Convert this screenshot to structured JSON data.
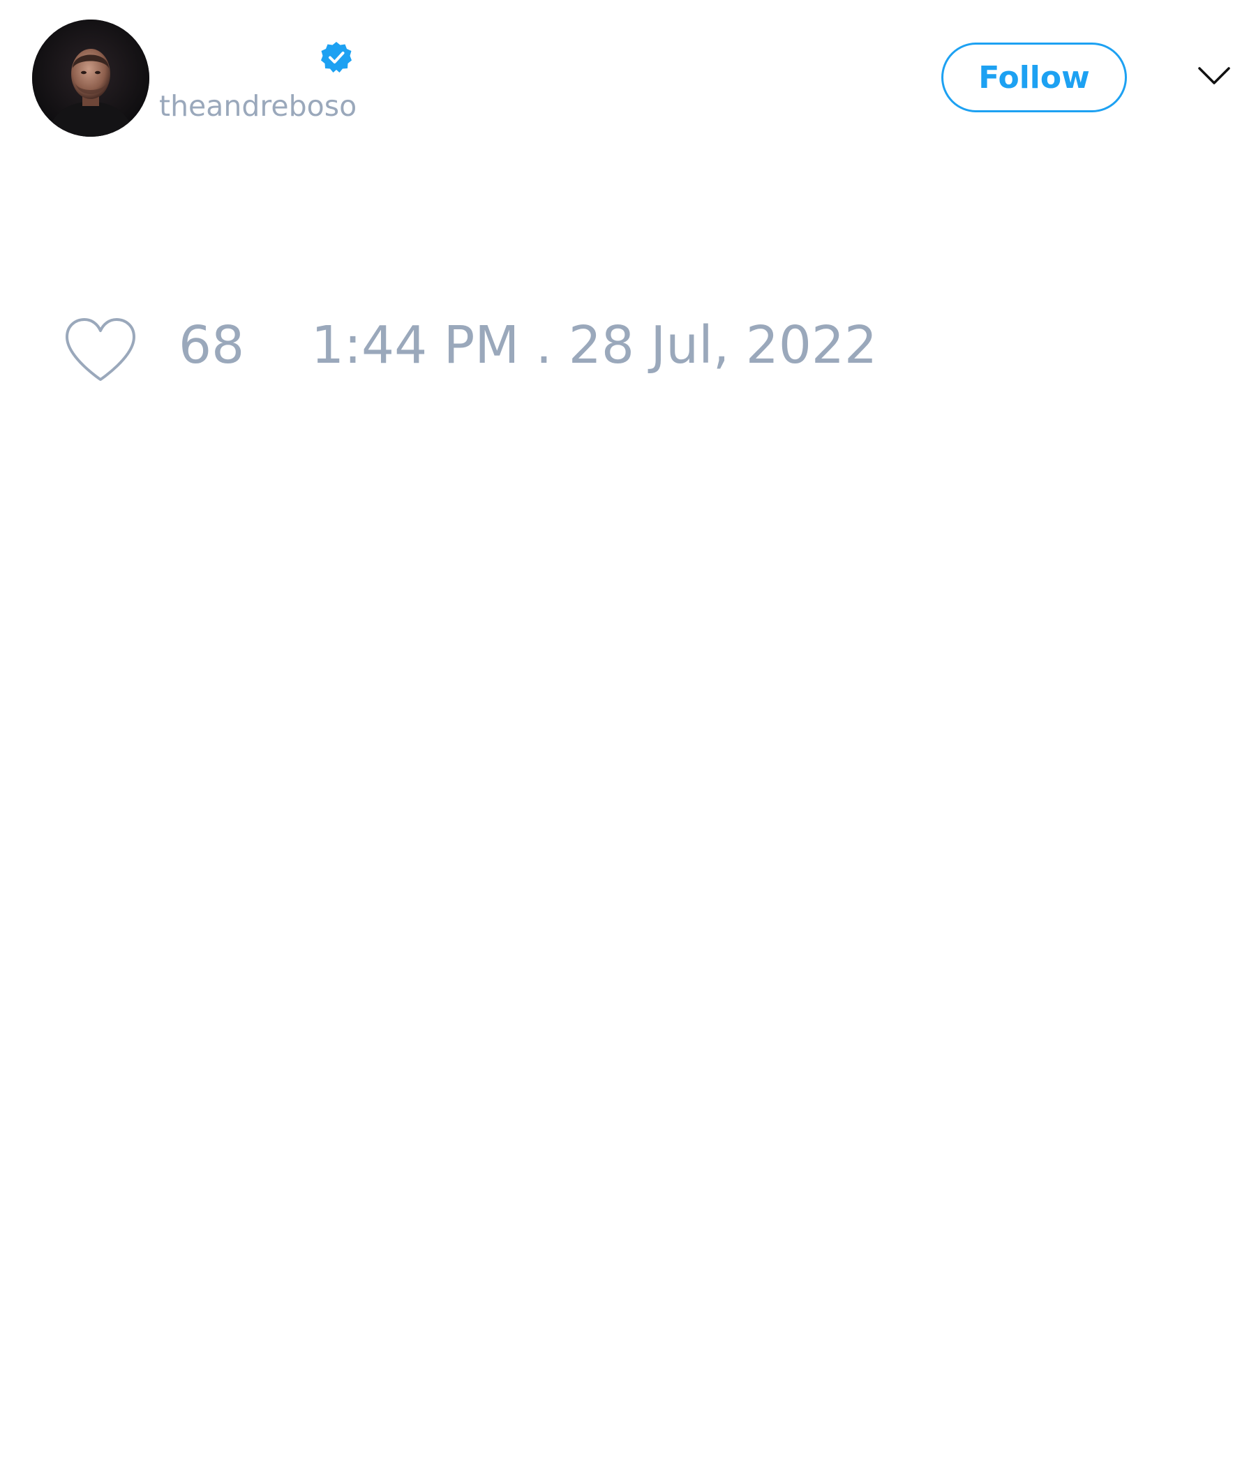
{
  "author": {
    "display_name": "",
    "handle": "theandreboso",
    "verified": true,
    "avatar": "avatar-photo",
    "verified_icon": "verified-badge-icon"
  },
  "header": {
    "follow_label": "Follow",
    "more_icon": "chevron-down-icon"
  },
  "engagement": {
    "like_icon": "heart-outline-icon",
    "like_count": "68",
    "timestamp": "1:44 PM . 28 Jul, 2022"
  },
  "colors": {
    "accent": "#1da1f2",
    "muted_text": "#9aa8bb",
    "background": "#ffffff",
    "icon_dark": "#111111"
  }
}
